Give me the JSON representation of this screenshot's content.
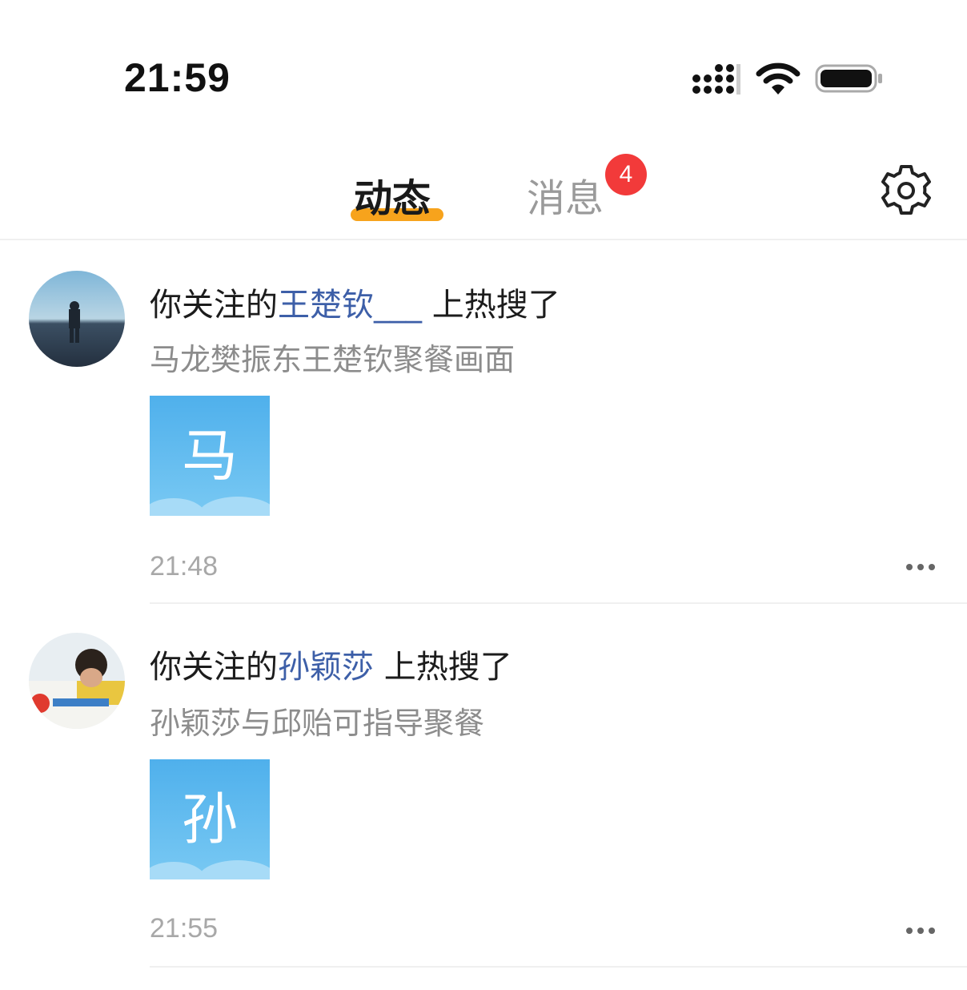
{
  "status_bar": {
    "time": "21:59",
    "signal_icon": "signal-icon",
    "wifi_icon": "wifi-icon",
    "battery_icon": "battery-icon"
  },
  "tabs": [
    {
      "label": "动态",
      "active": true,
      "underline_color": "#f7a31c"
    },
    {
      "label": "消息",
      "active": false,
      "badge": "4",
      "badge_color": "#f23a3a"
    }
  ],
  "settings_icon": "gear-icon",
  "feed": [
    {
      "prefix": "你关注的",
      "name": "王楚钦___",
      "suffix": " 上热搜了",
      "subtitle": "马龙樊振东王楚钦聚餐画面",
      "thumb_char": "马",
      "time": "21:48"
    },
    {
      "prefix": "你关注的",
      "name": "孙颖莎",
      "suffix": " 上热搜了",
      "subtitle": "孙颖莎与邱贻可指导聚餐",
      "thumb_char": "孙",
      "time": "21:55"
    }
  ],
  "colors": {
    "accent": "#f7a31c",
    "link": "#3d5fa8",
    "badge": "#f23a3a",
    "thumb_bg": "#5bb7ee"
  }
}
